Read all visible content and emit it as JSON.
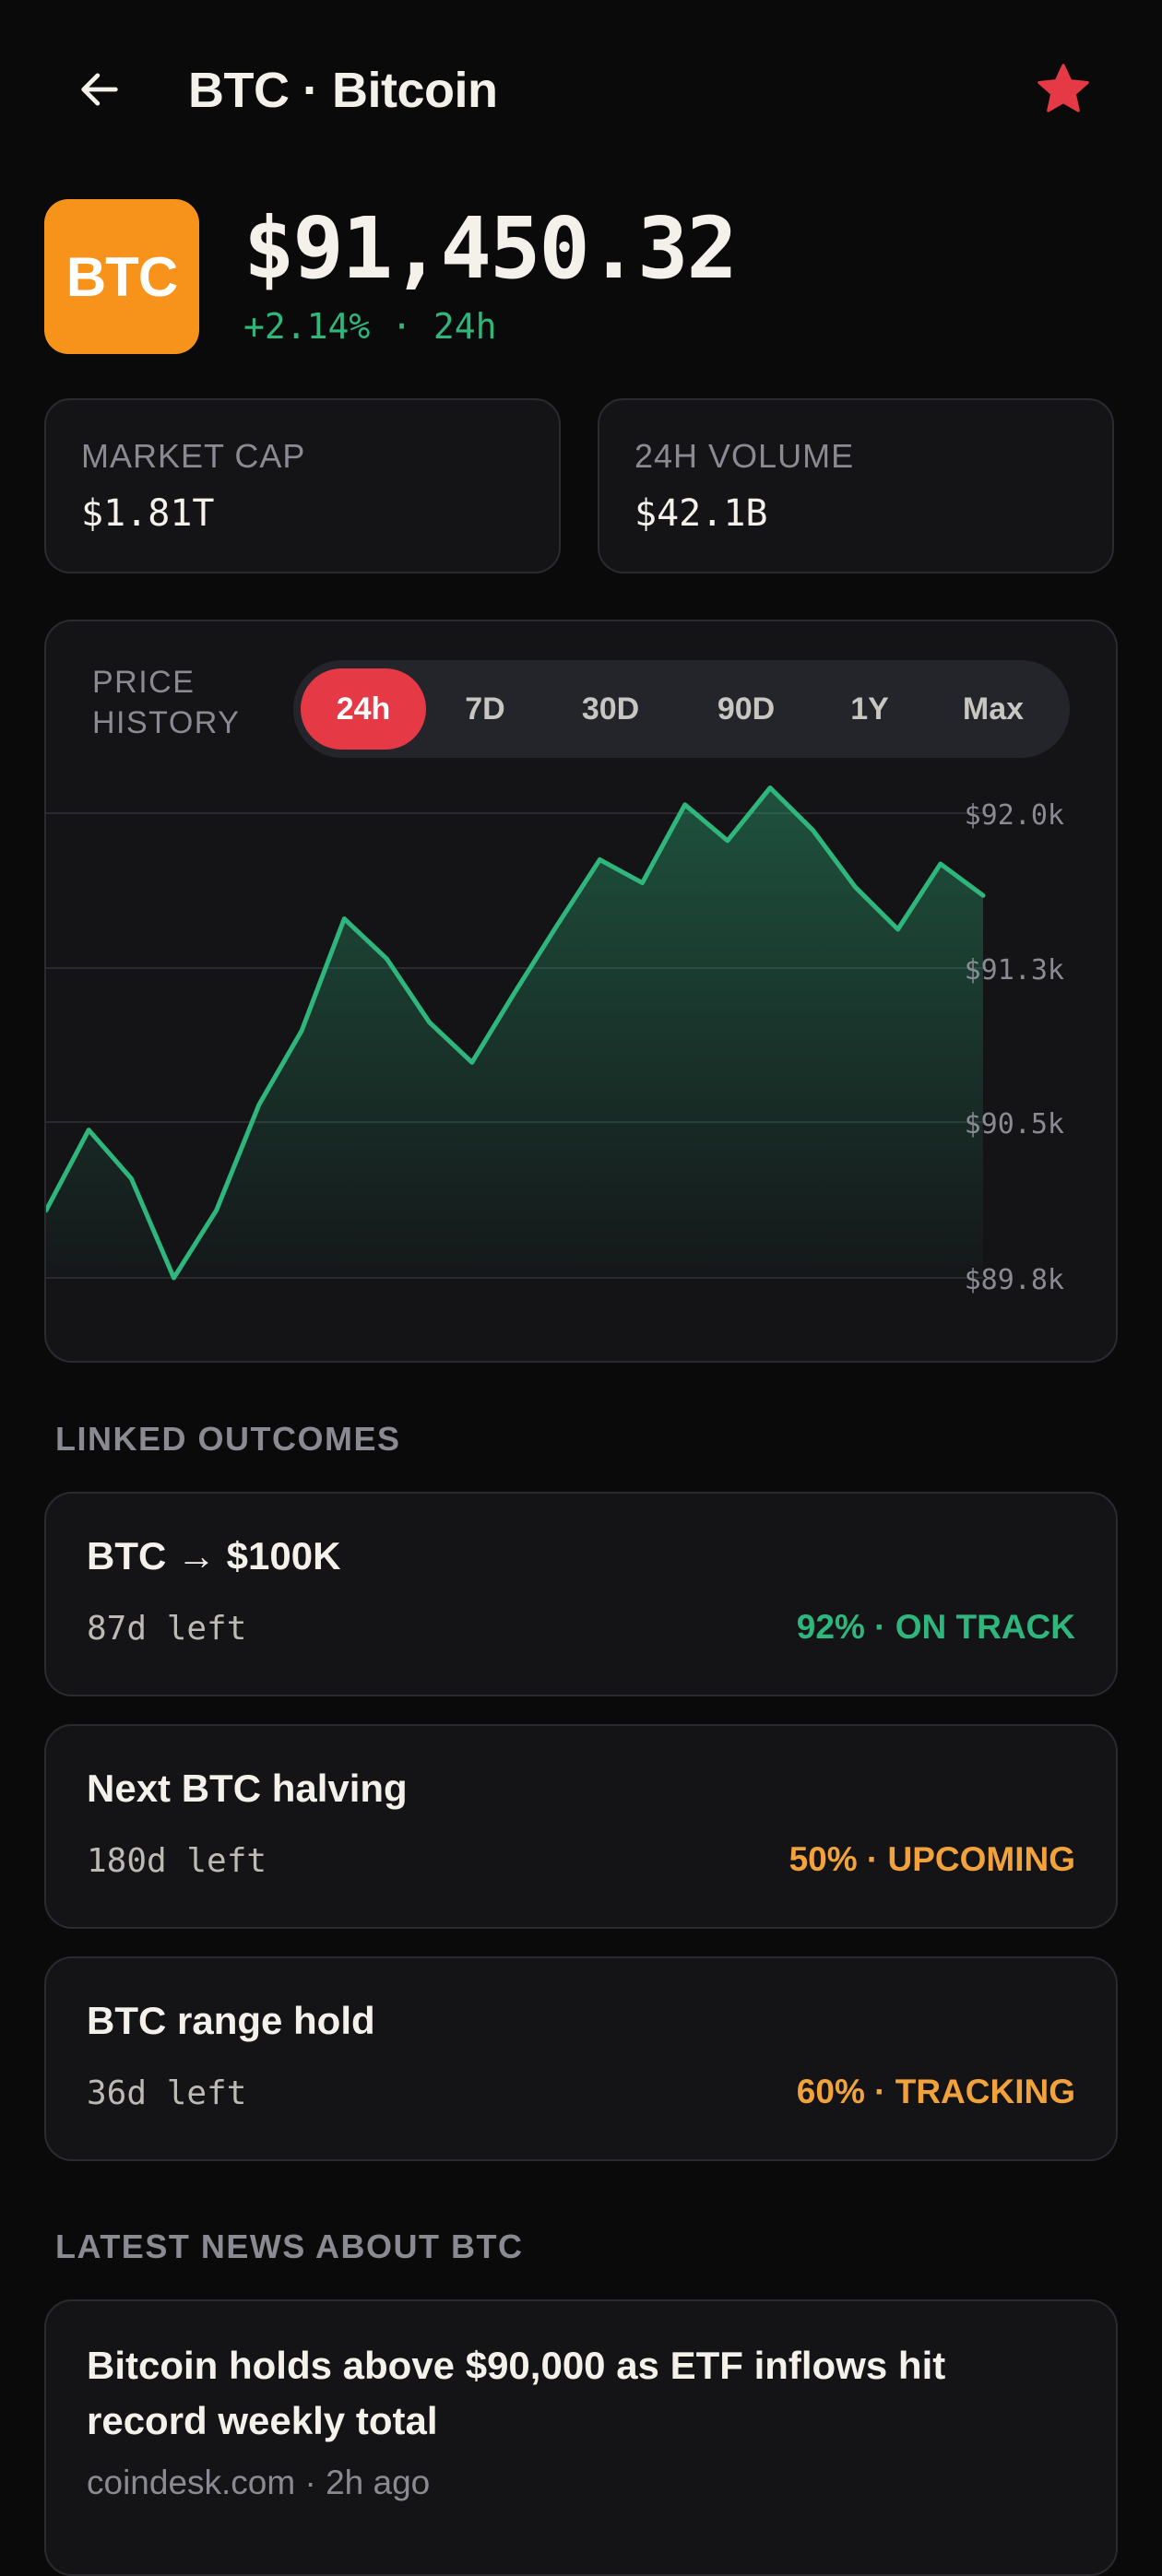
{
  "header": {
    "title": "BTC · Bitcoin",
    "back_icon": "arrow-left-icon",
    "favorite_icon": "star-icon"
  },
  "coin": {
    "logo_text": "BTC",
    "price": "$91,450.32",
    "change": "+2.14% · 24h"
  },
  "stats": [
    {
      "label": "MARKET CAP",
      "value": "$1.81T"
    },
    {
      "label": "24H VOLUME",
      "value": "$42.1B"
    }
  ],
  "chart_section": {
    "label": "PRICE HISTORY",
    "tabs": [
      "24h",
      "7D",
      "30D",
      "90D",
      "1Y",
      "Max"
    ],
    "active_tab": "24h"
  },
  "chart_data": {
    "type": "area",
    "title": "",
    "xlabel": "",
    "ylabel": "",
    "ylim": [
      89.8,
      92.0
    ],
    "ytick_labels": [
      "$92.0k",
      "$91.3k",
      "$90.5k",
      "$89.8k"
    ],
    "yticks": [
      92.0,
      91.3,
      90.5,
      89.8
    ],
    "grid": true,
    "series": [
      {
        "values": [
          90.12,
          90.5,
          90.27,
          89.8,
          90.12,
          90.62,
          90.97,
          91.5,
          91.31,
          91.01,
          90.82,
          91.15,
          91.47,
          91.78,
          91.67,
          92.04,
          91.87,
          92.12,
          91.92,
          91.65,
          91.45,
          91.76,
          91.61
        ]
      }
    ],
    "colors": {
      "line": "#2fb67c",
      "fill": "#2fb67c"
    }
  },
  "linked_outcomes": {
    "title": "LINKED OUTCOMES",
    "items": [
      {
        "name": "BTC → $100K",
        "time_left": "87d left",
        "status": "92% · ON TRACK",
        "color": "#2fb67c"
      },
      {
        "name": "Next BTC halving",
        "time_left": "180d left",
        "status": "50% · UPCOMING",
        "color": "#f2a23a"
      },
      {
        "name": "BTC range hold",
        "time_left": "36d left",
        "status": "60% · TRACKING",
        "color": "#f2a23a"
      }
    ]
  },
  "news": {
    "title": "LATEST NEWS ABOUT BTC",
    "items": [
      {
        "headline": "Bitcoin holds above $90,000 as ETF inflows hit record weekly total",
        "meta": "coindesk.com · 2h ago"
      }
    ]
  }
}
